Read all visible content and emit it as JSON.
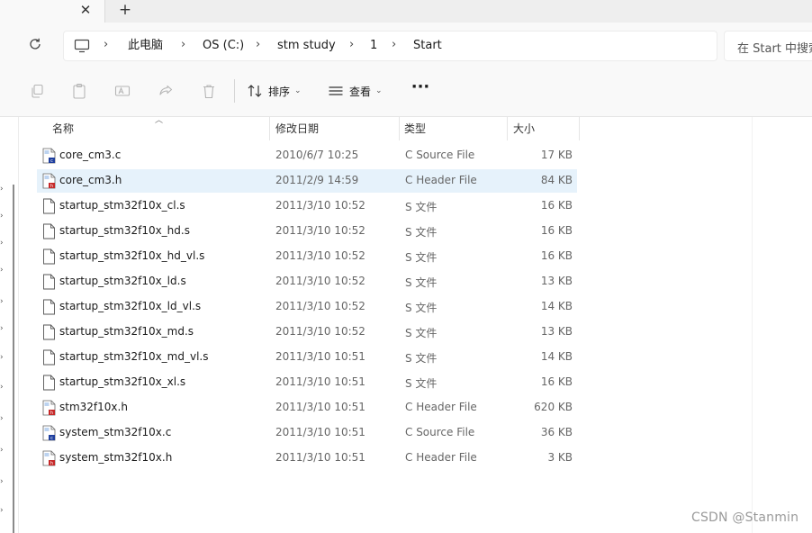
{
  "tab": {
    "close_glyph": "✕",
    "new_tab_glyph": "+"
  },
  "breadcrumb": [
    {
      "label": "此电脑"
    },
    {
      "label": "OS (C:)"
    },
    {
      "label": "stm study"
    },
    {
      "label": "1"
    },
    {
      "label": "Start"
    }
  ],
  "search": {
    "placeholder": "在 Start 中搜索"
  },
  "toolbar": {
    "sort_label": "排序",
    "view_label": "查看",
    "more_label": "···"
  },
  "columns": {
    "name": "名称",
    "date": "修改日期",
    "type": "类型",
    "size": "大小"
  },
  "files": [
    {
      "name": "core_cm3.c",
      "date": "2010/6/7 10:25",
      "type": "C Source File",
      "size": "17 KB",
      "icon": "c-source-icon",
      "selected": false
    },
    {
      "name": "core_cm3.h",
      "date": "2011/2/9 14:59",
      "type": "C Header File",
      "size": "84 KB",
      "icon": "c-header-icon",
      "selected": true
    },
    {
      "name": "startup_stm32f10x_cl.s",
      "date": "2011/3/10 10:52",
      "type": "S 文件",
      "size": "16 KB",
      "icon": "generic-file-icon",
      "selected": false
    },
    {
      "name": "startup_stm32f10x_hd.s",
      "date": "2011/3/10 10:52",
      "type": "S 文件",
      "size": "16 KB",
      "icon": "generic-file-icon",
      "selected": false
    },
    {
      "name": "startup_stm32f10x_hd_vl.s",
      "date": "2011/3/10 10:52",
      "type": "S 文件",
      "size": "16 KB",
      "icon": "generic-file-icon",
      "selected": false
    },
    {
      "name": "startup_stm32f10x_ld.s",
      "date": "2011/3/10 10:52",
      "type": "S 文件",
      "size": "13 KB",
      "icon": "generic-file-icon",
      "selected": false
    },
    {
      "name": "startup_stm32f10x_ld_vl.s",
      "date": "2011/3/10 10:52",
      "type": "S 文件",
      "size": "14 KB",
      "icon": "generic-file-icon",
      "selected": false
    },
    {
      "name": "startup_stm32f10x_md.s",
      "date": "2011/3/10 10:52",
      "type": "S 文件",
      "size": "13 KB",
      "icon": "generic-file-icon",
      "selected": false
    },
    {
      "name": "startup_stm32f10x_md_vl.s",
      "date": "2011/3/10 10:51",
      "type": "S 文件",
      "size": "14 KB",
      "icon": "generic-file-icon",
      "selected": false
    },
    {
      "name": "startup_stm32f10x_xl.s",
      "date": "2011/3/10 10:51",
      "type": "S 文件",
      "size": "16 KB",
      "icon": "generic-file-icon",
      "selected": false
    },
    {
      "name": "stm32f10x.h",
      "date": "2011/3/10 10:51",
      "type": "C Header File",
      "size": "620 KB",
      "icon": "c-header-icon",
      "selected": false
    },
    {
      "name": "system_stm32f10x.c",
      "date": "2011/3/10 10:51",
      "type": "C Source File",
      "size": "36 KB",
      "icon": "c-source-icon",
      "selected": false
    },
    {
      "name": "system_stm32f10x.h",
      "date": "2011/3/10 10:51",
      "type": "C Header File",
      "size": "3 KB",
      "icon": "c-header-icon",
      "selected": false
    }
  ],
  "watermark": "CSDN @Stanmin",
  "colors": {
    "selection": "#e6f2fb",
    "c_source_accent": "#1f3f9e",
    "c_header_accent": "#c62828"
  }
}
